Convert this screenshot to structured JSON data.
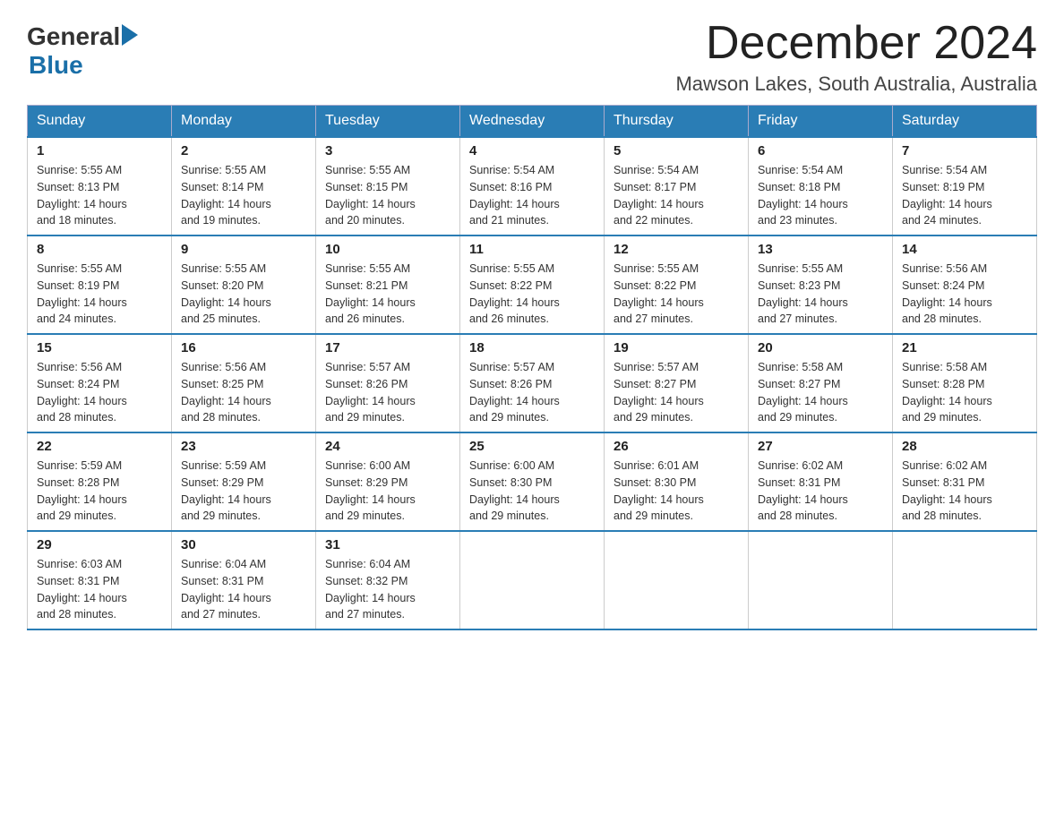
{
  "logo": {
    "general": "General",
    "blue": "Blue"
  },
  "header": {
    "month": "December 2024",
    "location": "Mawson Lakes, South Australia, Australia"
  },
  "weekdays": [
    "Sunday",
    "Monday",
    "Tuesday",
    "Wednesday",
    "Thursday",
    "Friday",
    "Saturday"
  ],
  "weeks": [
    [
      {
        "day": "1",
        "sunrise": "5:55 AM",
        "sunset": "8:13 PM",
        "daylight": "14 hours and 18 minutes."
      },
      {
        "day": "2",
        "sunrise": "5:55 AM",
        "sunset": "8:14 PM",
        "daylight": "14 hours and 19 minutes."
      },
      {
        "day": "3",
        "sunrise": "5:55 AM",
        "sunset": "8:15 PM",
        "daylight": "14 hours and 20 minutes."
      },
      {
        "day": "4",
        "sunrise": "5:54 AM",
        "sunset": "8:16 PM",
        "daylight": "14 hours and 21 minutes."
      },
      {
        "day": "5",
        "sunrise": "5:54 AM",
        "sunset": "8:17 PM",
        "daylight": "14 hours and 22 minutes."
      },
      {
        "day": "6",
        "sunrise": "5:54 AM",
        "sunset": "8:18 PM",
        "daylight": "14 hours and 23 minutes."
      },
      {
        "day": "7",
        "sunrise": "5:54 AM",
        "sunset": "8:19 PM",
        "daylight": "14 hours and 24 minutes."
      }
    ],
    [
      {
        "day": "8",
        "sunrise": "5:55 AM",
        "sunset": "8:19 PM",
        "daylight": "14 hours and 24 minutes."
      },
      {
        "day": "9",
        "sunrise": "5:55 AM",
        "sunset": "8:20 PM",
        "daylight": "14 hours and 25 minutes."
      },
      {
        "day": "10",
        "sunrise": "5:55 AM",
        "sunset": "8:21 PM",
        "daylight": "14 hours and 26 minutes."
      },
      {
        "day": "11",
        "sunrise": "5:55 AM",
        "sunset": "8:22 PM",
        "daylight": "14 hours and 26 minutes."
      },
      {
        "day": "12",
        "sunrise": "5:55 AM",
        "sunset": "8:22 PM",
        "daylight": "14 hours and 27 minutes."
      },
      {
        "day": "13",
        "sunrise": "5:55 AM",
        "sunset": "8:23 PM",
        "daylight": "14 hours and 27 minutes."
      },
      {
        "day": "14",
        "sunrise": "5:56 AM",
        "sunset": "8:24 PM",
        "daylight": "14 hours and 28 minutes."
      }
    ],
    [
      {
        "day": "15",
        "sunrise": "5:56 AM",
        "sunset": "8:24 PM",
        "daylight": "14 hours and 28 minutes."
      },
      {
        "day": "16",
        "sunrise": "5:56 AM",
        "sunset": "8:25 PM",
        "daylight": "14 hours and 28 minutes."
      },
      {
        "day": "17",
        "sunrise": "5:57 AM",
        "sunset": "8:26 PM",
        "daylight": "14 hours and 29 minutes."
      },
      {
        "day": "18",
        "sunrise": "5:57 AM",
        "sunset": "8:26 PM",
        "daylight": "14 hours and 29 minutes."
      },
      {
        "day": "19",
        "sunrise": "5:57 AM",
        "sunset": "8:27 PM",
        "daylight": "14 hours and 29 minutes."
      },
      {
        "day": "20",
        "sunrise": "5:58 AM",
        "sunset": "8:27 PM",
        "daylight": "14 hours and 29 minutes."
      },
      {
        "day": "21",
        "sunrise": "5:58 AM",
        "sunset": "8:28 PM",
        "daylight": "14 hours and 29 minutes."
      }
    ],
    [
      {
        "day": "22",
        "sunrise": "5:59 AM",
        "sunset": "8:28 PM",
        "daylight": "14 hours and 29 minutes."
      },
      {
        "day": "23",
        "sunrise": "5:59 AM",
        "sunset": "8:29 PM",
        "daylight": "14 hours and 29 minutes."
      },
      {
        "day": "24",
        "sunrise": "6:00 AM",
        "sunset": "8:29 PM",
        "daylight": "14 hours and 29 minutes."
      },
      {
        "day": "25",
        "sunrise": "6:00 AM",
        "sunset": "8:30 PM",
        "daylight": "14 hours and 29 minutes."
      },
      {
        "day": "26",
        "sunrise": "6:01 AM",
        "sunset": "8:30 PM",
        "daylight": "14 hours and 29 minutes."
      },
      {
        "day": "27",
        "sunrise": "6:02 AM",
        "sunset": "8:31 PM",
        "daylight": "14 hours and 28 minutes."
      },
      {
        "day": "28",
        "sunrise": "6:02 AM",
        "sunset": "8:31 PM",
        "daylight": "14 hours and 28 minutes."
      }
    ],
    [
      {
        "day": "29",
        "sunrise": "6:03 AM",
        "sunset": "8:31 PM",
        "daylight": "14 hours and 28 minutes."
      },
      {
        "day": "30",
        "sunrise": "6:04 AM",
        "sunset": "8:31 PM",
        "daylight": "14 hours and 27 minutes."
      },
      {
        "day": "31",
        "sunrise": "6:04 AM",
        "sunset": "8:32 PM",
        "daylight": "14 hours and 27 minutes."
      },
      null,
      null,
      null,
      null
    ]
  ],
  "labels": {
    "sunrise": "Sunrise: ",
    "sunset": "Sunset: ",
    "daylight": "Daylight: "
  }
}
